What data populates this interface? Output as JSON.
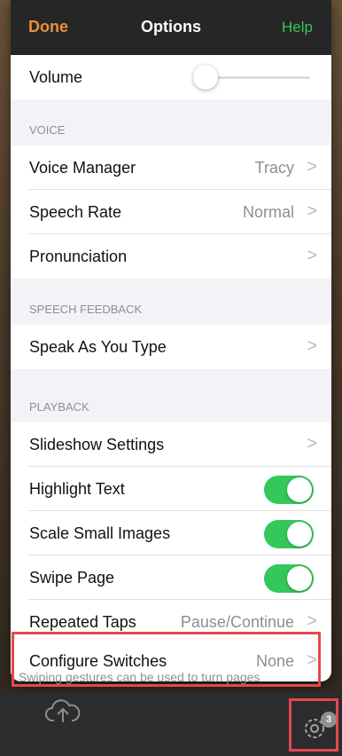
{
  "navbar": {
    "done_label": "Done",
    "title": "Options",
    "help_label": "Help"
  },
  "volume": {
    "label": "Volume",
    "level": 0.12
  },
  "sections": {
    "voice": "VOICE",
    "speech_feedback": "SPEECH FEEDBACK",
    "playback": "PLAYBACK"
  },
  "rows": {
    "voice_manager": {
      "label": "Voice Manager",
      "value": "Tracy",
      "chevron": ">"
    },
    "speech_rate": {
      "label": "Speech Rate",
      "value": "Normal",
      "chevron": ">"
    },
    "pronunciation": {
      "label": "Pronunciation",
      "chevron": ">"
    },
    "speak_as_you_type": {
      "label": "Speak As You Type",
      "chevron": ">"
    },
    "slideshow_settings": {
      "label": "Slideshow Settings",
      "chevron": ">"
    },
    "highlight_text": {
      "label": "Highlight Text",
      "on": true
    },
    "scale_small_images": {
      "label": "Scale Small Images",
      "on": true
    },
    "swipe_page": {
      "label": "Swipe Page",
      "on": true
    },
    "repeated_taps": {
      "label": "Repeated Taps",
      "value": "Pause/Continue",
      "chevron": ">"
    },
    "configure_switches": {
      "label": "Configure Switches",
      "value": "None",
      "chevron": ">"
    }
  },
  "footer_note": "Swiping gestures can be used to turn pages",
  "toolbar": {
    "cloud_icon": "cloud-upload-icon",
    "gear_icon": "gear-icon",
    "gear_badge": "3"
  },
  "colors": {
    "accent_orange": "#e8913a",
    "accent_green": "#34c759",
    "highlight_red": "#e5484d"
  }
}
